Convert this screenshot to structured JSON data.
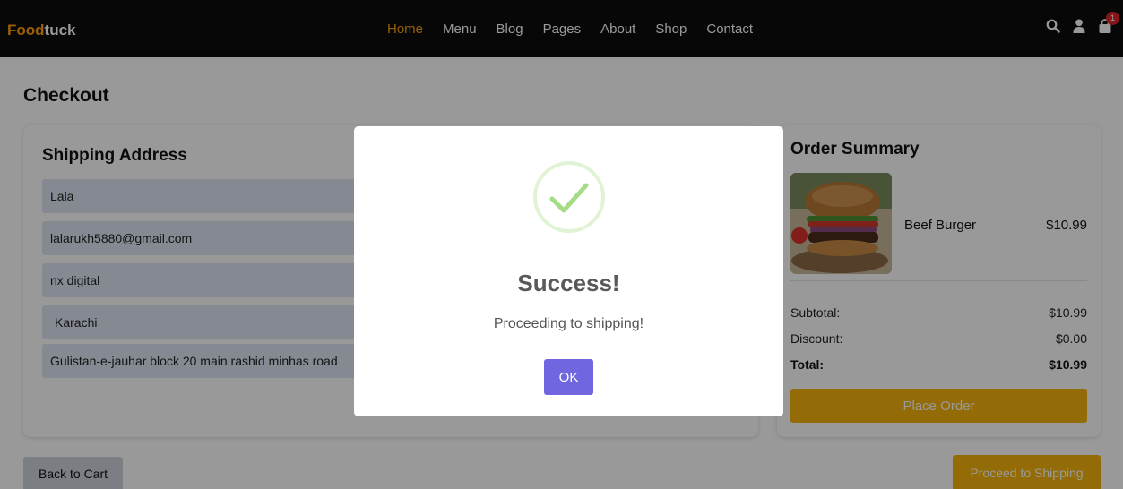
{
  "nav": {
    "brand_accent": "Food",
    "brand_rest": "tuck",
    "links": [
      "Home",
      "Menu",
      "Blog",
      "Pages",
      "About",
      "Shop",
      "Contact"
    ],
    "active_link": "Home",
    "icons": [
      "search-icon",
      "user-icon",
      "cart-icon"
    ],
    "cart_count": "1",
    "accent_color": "#ff9f0d"
  },
  "page": {
    "title": "Checkout"
  },
  "shipping": {
    "heading": "Shipping Address",
    "fields": [
      "Lala",
      "lalarukh5880@gmail.com",
      "nx digital",
      "Karachi",
      "Gulistan-e-jauhar block 20 main rashid minhas road"
    ]
  },
  "summary": {
    "heading": "Order Summary",
    "item": {
      "name": "Beef Burger",
      "price": "$10.99"
    },
    "subtotal_label": "Subtotal:",
    "subtotal_value": "$10.99",
    "discount_label": "Discount:",
    "discount_value": "$0.00",
    "total_label": "Total:",
    "total_value": "$10.99",
    "place_order_label": "Place Order"
  },
  "actions": {
    "back_label": "Back to Cart",
    "proceed_label": "Proceed to Shipping"
  },
  "modal": {
    "title": "Success!",
    "text": "Proceeding to shipping!",
    "ok_label": "OK",
    "icon": "check-icon"
  },
  "colors": {
    "button_yellow": "#f5b50c",
    "ok_button": "#7066e0",
    "success_green": "#a5dc86"
  }
}
